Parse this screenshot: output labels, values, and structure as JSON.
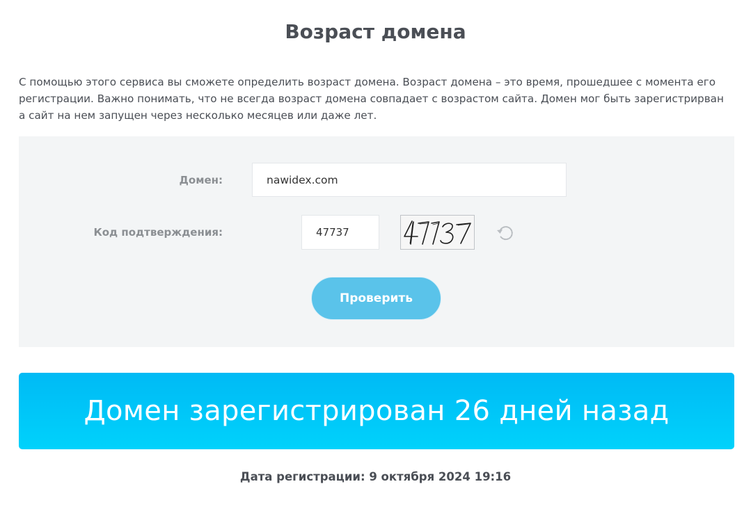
{
  "page": {
    "title": "Возраст домена",
    "intro": "С помощью этого сервиса вы сможете определить возраст домена. Возраст домена – это время, прошедшее с момента его регистрации. Важно понимать, что не всегда возраст домена совпадает с возрастом сайта. Домен мог быть зарегистрирван а сайт на нем запущен через несколько месяцев или даже лет."
  },
  "form": {
    "domain_label": "Домен:",
    "domain_value": "nawidex.com",
    "code_label": "Код подтверждения:",
    "code_value": "47737",
    "captcha_text": "47737",
    "refresh_icon": "refresh-icon",
    "submit_label": "Проверить"
  },
  "result": {
    "banner_text": "Домен зарегистрирован 26 дней назад",
    "registration_date": "Дата регистрации: 9 октября 2024 19:16"
  },
  "colors": {
    "button": "#5ac3ea",
    "banner_top": "#00baf5",
    "banner_bottom": "#00d2fb",
    "panel": "#f3f5f6"
  }
}
